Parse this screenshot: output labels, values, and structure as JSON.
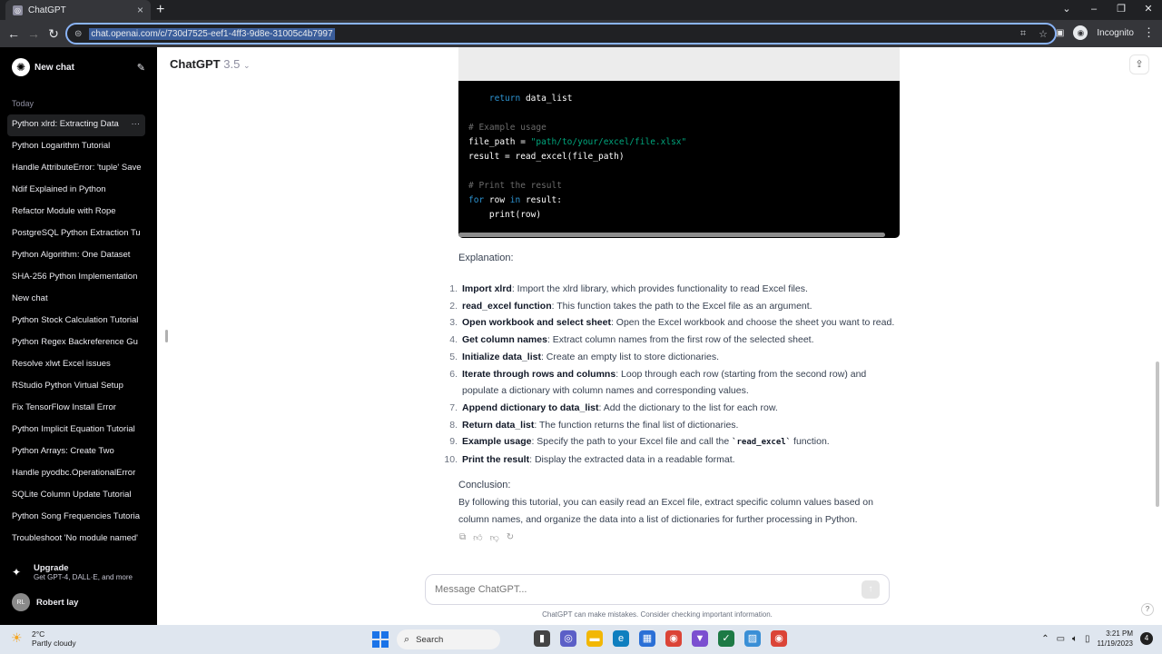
{
  "browser": {
    "tab_title": "ChatGPT",
    "url": "chat.openai.com/c/730d7525-eef1-4ff3-9d8e-31005c4b7997",
    "profile_label": "Incognito"
  },
  "sidebar": {
    "new_chat_label": "New chat",
    "section_label": "Today",
    "items": [
      {
        "label": "Python xlrd: Extracting Data"
      },
      {
        "label": "Python Logarithm Tutorial"
      },
      {
        "label": "Handle AttributeError: 'tuple' Save"
      },
      {
        "label": "Ndif Explained in Python"
      },
      {
        "label": "Refactor Module with Rope"
      },
      {
        "label": "PostgreSQL Python Extraction Tu"
      },
      {
        "label": "Python Algorithm: One Dataset"
      },
      {
        "label": "SHA-256 Python Implementation"
      },
      {
        "label": "New chat"
      },
      {
        "label": "Python Stock Calculation Tutorial"
      },
      {
        "label": "Python Regex Backreference Gu"
      },
      {
        "label": "Resolve xlwt Excel issues"
      },
      {
        "label": "RStudio Python Virtual Setup"
      },
      {
        "label": "Fix TensorFlow Install Error"
      },
      {
        "label": "Python Implicit Equation Tutorial"
      },
      {
        "label": "Python Arrays: Create Two"
      },
      {
        "label": "Handle pyodbc.OperationalError"
      },
      {
        "label": "SQLite Column Update Tutorial"
      },
      {
        "label": "Python Song Frequencies Tutoria"
      },
      {
        "label": "Troubleshoot 'No module named'"
      }
    ],
    "upgrade_title": "Upgrade",
    "upgrade_subtitle": "Get GPT-4, DALL·E, and more",
    "user_initials": "RL",
    "user_name": "Robert lay"
  },
  "header": {
    "model_name": "ChatGPT",
    "model_version": "3.5"
  },
  "code": {
    "lines": [
      {
        "text": "    return data_list",
        "kind": "return"
      },
      {
        "text": "# Example usage",
        "kind": "comment"
      },
      {
        "text": "file_path = \"path/to/your/excel/file.xlsx\"",
        "kind": "assign_str"
      },
      {
        "text": "result = read_excel(file_path)",
        "kind": "plain"
      },
      {
        "text": "# Print the result",
        "kind": "comment"
      },
      {
        "text": "for row in result:",
        "kind": "for"
      },
      {
        "text": "    print(row)",
        "kind": "plain"
      }
    ]
  },
  "message": {
    "explanation_heading": "Explanation:",
    "steps": [
      {
        "num": "1.",
        "title": "Import xlrd",
        "text": ": Import the xlrd library, which provides functionality to read Excel files."
      },
      {
        "num": "2.",
        "title": "read_excel function",
        "text": ": This function takes the path to the Excel file as an argument."
      },
      {
        "num": "3.",
        "title": "Open workbook and select sheet",
        "text": ": Open the Excel workbook and choose the sheet you want to read."
      },
      {
        "num": "4.",
        "title": "Get column names",
        "text": ": Extract column names from the first row of the selected sheet."
      },
      {
        "num": "5.",
        "title": "Initialize data_list",
        "text": ": Create an empty list to store dictionaries."
      },
      {
        "num": "6.",
        "title": "Iterate through rows and columns",
        "text": ": Loop through each row (starting from the second row) and populate a dictionary with column names and corresponding values."
      },
      {
        "num": "7.",
        "title": "Append dictionary to data_list",
        "text": ": Add the dictionary to the list for each row."
      },
      {
        "num": "8.",
        "title": "Return data_list",
        "text": ": The function returns the final list of dictionaries."
      },
      {
        "num": "9.",
        "title": "Example usage",
        "text": ": Specify the path to your Excel file and call the ",
        "code": "`read_excel`",
        "text_after": " function."
      },
      {
        "num": "10.",
        "title": "Print the result",
        "text": ": Display the extracted data in a readable format."
      }
    ],
    "conclusion_heading": "Conclusion:",
    "conclusion_text": "By following this tutorial, you can easily read an Excel file, extract specific column values based on column names, and organize the data into a list of dictionaries for further processing in Python."
  },
  "composer": {
    "placeholder": "Message ChatGPT...",
    "disclaimer": "ChatGPT can make mistakes. Consider checking important information."
  },
  "taskbar": {
    "temperature": "2°C",
    "weather": "Partly cloudy",
    "search_label": "Search",
    "time": "3:21 PM",
    "date": "11/19/2023",
    "notification_count": "4"
  }
}
